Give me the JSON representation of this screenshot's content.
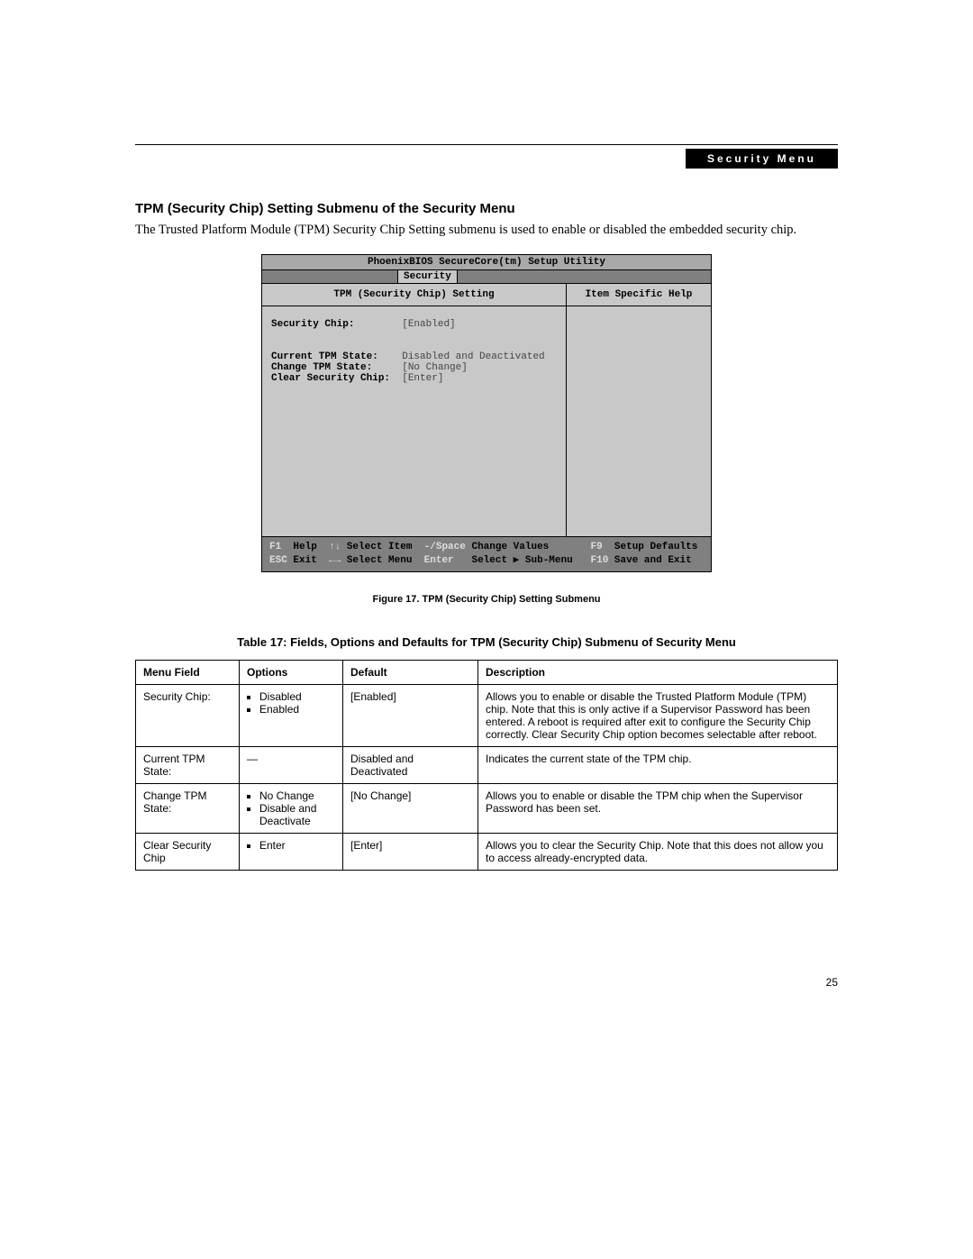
{
  "header": {
    "badge": "Security Menu"
  },
  "section": {
    "title": "TPM (Security Chip) Setting Submenu of the Security Menu",
    "intro": "The Trusted Platform Module (TPM) Security Chip Setting submenu is used to enable or disabled the embedded security chip."
  },
  "bios": {
    "title": "PhoenixBIOS SecureCore(tm) Setup Utility",
    "tab": "Security",
    "left_header": "TPM (Security Chip) Setting",
    "right_header": "Item Specific Help",
    "rows": [
      {
        "label": "Security Chip:",
        "value": "[Enabled]"
      },
      {
        "label": "",
        "value": ""
      },
      {
        "label": "Current TPM State:",
        "value": "Disabled and Deactivated"
      },
      {
        "label": "Change TPM State:",
        "value": "[No Change]"
      },
      {
        "label": "Clear Security Chip:",
        "value": "[Enter]"
      }
    ],
    "footer": {
      "line1_keys": [
        "F1",
        "↑↓",
        "-/Space",
        "F9"
      ],
      "line1_labels": [
        "Help",
        "Select Item",
        "Change Values",
        "Setup Defaults"
      ],
      "line2_keys": [
        "ESC",
        "←→",
        "Enter",
        "F10"
      ],
      "line2_labels": [
        "Exit",
        "Select Menu",
        "Select ▶ Sub-Menu",
        "Save and Exit"
      ]
    }
  },
  "figure_caption": "Figure 17.  TPM (Security Chip) Setting Submenu",
  "table_caption": "Table 17: Fields, Options and Defaults for TPM (Security Chip) Submenu of Security Menu",
  "table": {
    "headers": [
      "Menu Field",
      "Options",
      "Default",
      "Description"
    ],
    "rows": [
      {
        "field": "Security Chip:",
        "options": [
          "Disabled",
          "Enabled"
        ],
        "default": "[Enabled]",
        "description": "Allows you to enable or disable the Trusted Platform Module (TPM) chip. Note that this is only active if a Supervisor Password has been entered. A reboot is required after exit to configure the Security Chip correctly. Clear Security Chip option becomes selectable after reboot."
      },
      {
        "field": "Current TPM State:",
        "options_text": "—",
        "default": "Disabled and Deactivated",
        "description": "Indicates the current state of the TPM chip."
      },
      {
        "field": "Change TPM State:",
        "options": [
          "No Change",
          "Disable and Deactivate"
        ],
        "default": "[No Change]",
        "description": "Allows you to enable or disable the TPM chip when the Supervisor Password has been set."
      },
      {
        "field": "Clear Security Chip",
        "options": [
          "Enter"
        ],
        "default": "[Enter]",
        "description": "Allows you to clear the Security Chip. Note that this does not allow you to access already-encrypted data."
      }
    ]
  },
  "page_number": "25"
}
